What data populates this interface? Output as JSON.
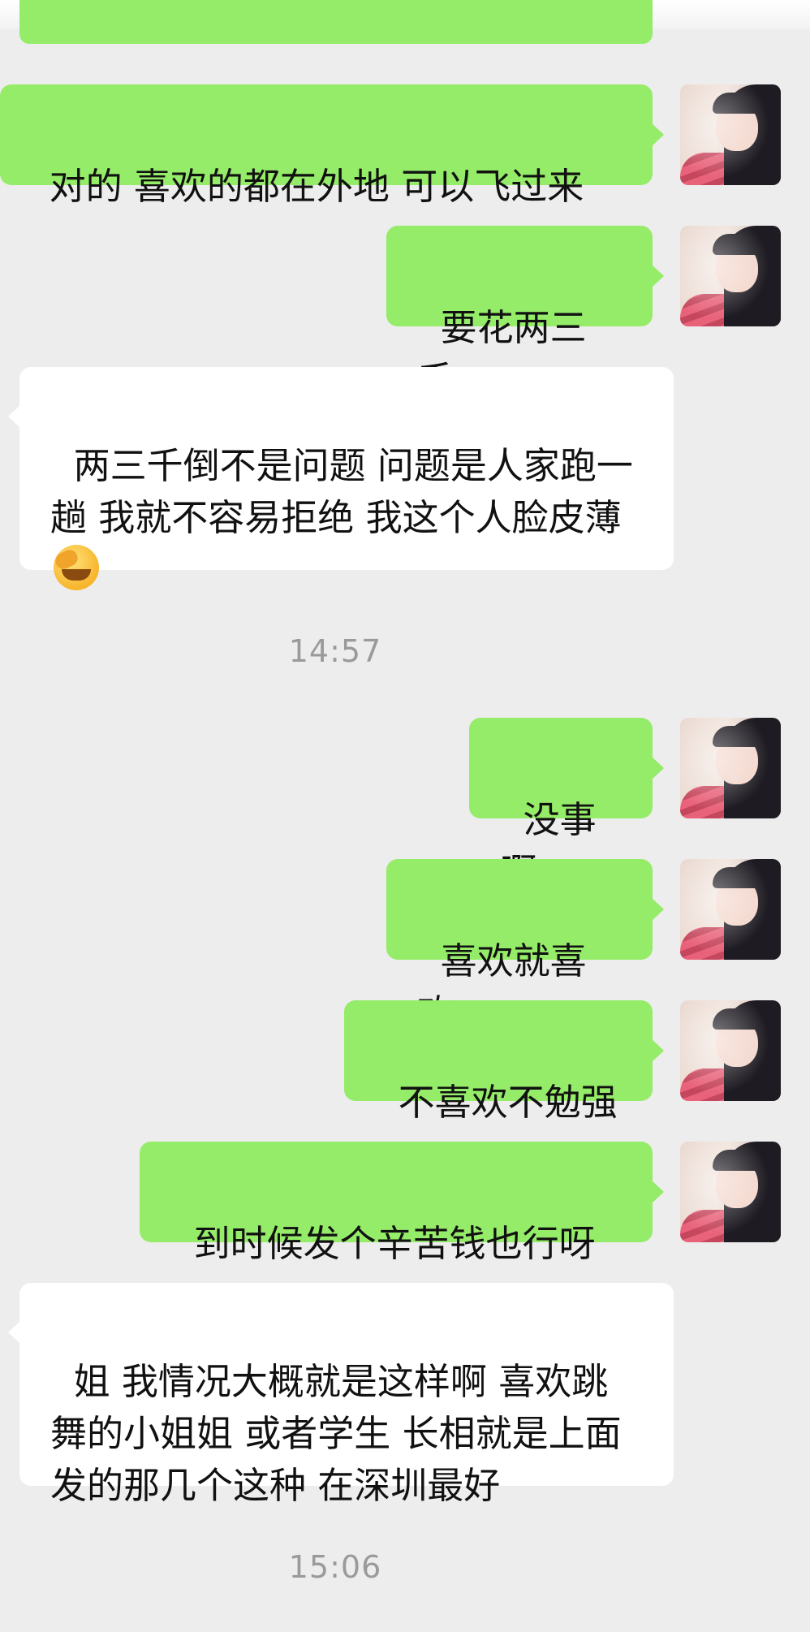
{
  "messages": [
    {
      "id": "m1",
      "side": "me",
      "text": "对的 喜欢的都在外地 可以飞过来"
    },
    {
      "id": "m2",
      "side": "me",
      "text": "要花两三千"
    },
    {
      "id": "m3",
      "side": "them",
      "text": "两三千倒不是问题 问题是人家跑一趟 我就不容易拒绝 我这个人脸皮薄",
      "emoji": "face-with-hand-over-mouth"
    },
    {
      "id": "m4",
      "side": "me",
      "text": "没事啊"
    },
    {
      "id": "m5",
      "side": "me",
      "text": "喜欢就喜欢"
    },
    {
      "id": "m6",
      "side": "me",
      "text": "不喜欢不勉强"
    },
    {
      "id": "m7",
      "side": "me",
      "text": "到时候发个辛苦钱也行呀"
    },
    {
      "id": "m8",
      "side": "them",
      "text": "姐 我情况大概就是这样啊 喜欢跳舞的小姐姐 或者学生 长相就是上面发的那几个这种 在深圳最好"
    }
  ],
  "timestamps": {
    "t1": "14:57",
    "t2": "15:06"
  },
  "colors": {
    "outgoing": "#95ec69",
    "incoming": "#ffffff",
    "background": "#ededed",
    "timestamp": "#9a9a9a"
  }
}
